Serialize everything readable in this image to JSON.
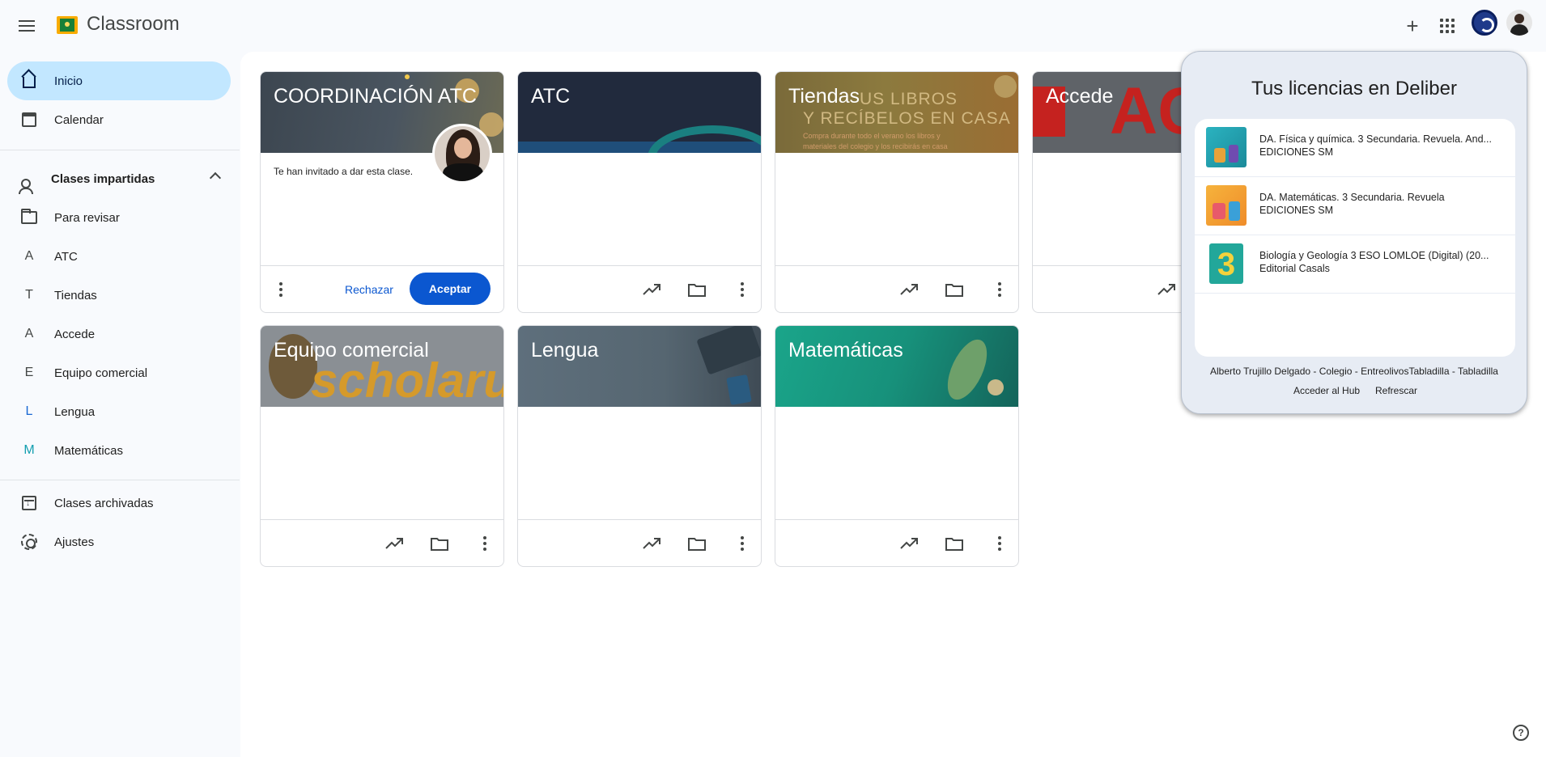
{
  "app": {
    "title": "Classroom"
  },
  "header": {
    "menu_icon": "hamburger-menu-icon",
    "create_icon": "plus-icon",
    "apps_icon": "google-apps-icon",
    "extension_icon": "deliber-extension-icon",
    "avatar_icon": "account-avatar-icon"
  },
  "sidebar": {
    "home": {
      "label": "Inicio",
      "icon": "home-icon"
    },
    "calendar": {
      "label": "Calendar",
      "icon": "calendar-icon"
    },
    "teaching": {
      "label": "Clases impartidas",
      "icon": "teacher-icon"
    },
    "review": {
      "label": "Para revisar",
      "icon": "folder-review-icon"
    },
    "classes": [
      {
        "letter": "A",
        "label": "ATC",
        "color": "#444746"
      },
      {
        "letter": "T",
        "label": "Tiendas",
        "color": "#444746"
      },
      {
        "letter": "A",
        "label": "Accede",
        "color": "#444746"
      },
      {
        "letter": "E",
        "label": "Equipo comercial",
        "color": "#444746"
      },
      {
        "letter": "L",
        "label": "Lengua",
        "color": "#1967d2"
      },
      {
        "letter": "M",
        "label": "Matemáticas",
        "color": "#129eaf"
      }
    ],
    "archived": {
      "label": "Clases archivadas",
      "icon": "archive-icon"
    },
    "settings": {
      "label": "Ajustes",
      "icon": "gear-icon"
    }
  },
  "cards": {
    "coordinacion": {
      "title": "COORDINACIÓN ATC",
      "invite": "Te han invitado a dar esta clase.",
      "reject": "Rechazar",
      "accept": "Aceptar"
    },
    "atc": {
      "title": "ATC"
    },
    "tiendas": {
      "title": "Tiendas",
      "banner_line1": "US LIBROS",
      "banner_line2": "Y RECÍBELOS EN CASA",
      "banner_line3": "Compra durante todo el verano los libros y",
      "banner_line4": "materiales del colegio y los recibirás en casa"
    },
    "accede": {
      "title": "Accede",
      "banner_text": "AC"
    },
    "equipo": {
      "title": "Equipo comercial",
      "banner_text": "scholaru"
    },
    "lengua": {
      "title": "Lengua"
    },
    "matematicas": {
      "title": "Matemáticas"
    }
  },
  "deliber": {
    "title": "Tus licencias en Deliber",
    "licenses": [
      {
        "title": "DA. Física y química. 3 Secundaria. Revuela. And...",
        "publisher": "EDICIONES SM"
      },
      {
        "title": "DA. Matemáticas. 3 Secundaria. Revuela",
        "publisher": "EDICIONES SM"
      },
      {
        "title": "Biología y Geología 3 ESO LOMLOE (Digital) (20...",
        "publisher": "Editorial Casals",
        "cover_text": "3"
      }
    ],
    "user_line": "Alberto Trujillo Delgado - Colegio - EntreolivosTabladilla - Tabladilla",
    "hub_link": "Acceder al Hub",
    "refresh_link": "Refrescar"
  },
  "help": {
    "icon": "help-icon",
    "symbol": "?"
  }
}
